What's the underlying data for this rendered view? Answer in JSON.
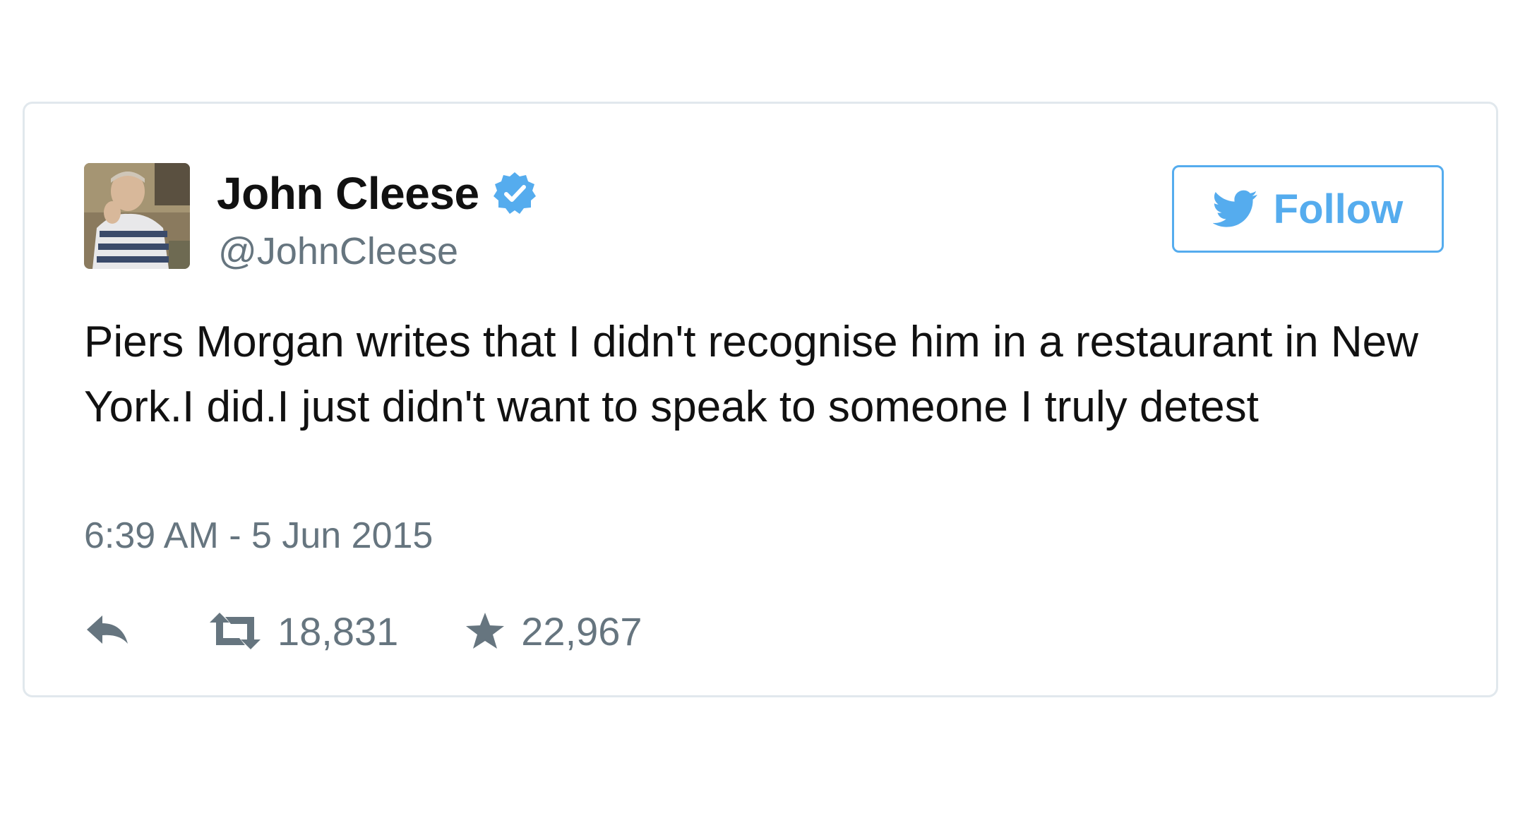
{
  "tweet": {
    "author": {
      "display_name": "John Cleese",
      "handle": "@JohnCleese",
      "verified": true
    },
    "follow_label": "Follow",
    "text": "Piers Morgan writes that I didn't recognise him in a restaurant in New York.I did.I just didn't want to speak to someone I truly detest",
    "timestamp": "6:39 AM - 5 Jun 2015",
    "actions": {
      "retweet_count": "18,831",
      "favorite_count": "22,967"
    }
  },
  "icons": [
    "verified-badge-icon",
    "twitter-bird-icon",
    "reply-icon",
    "retweet-icon",
    "star-icon"
  ],
  "colors": {
    "accent": "#55acee",
    "text_primary": "#111111",
    "text_secondary": "#66757f",
    "card_border": "#e1e8ed"
  }
}
